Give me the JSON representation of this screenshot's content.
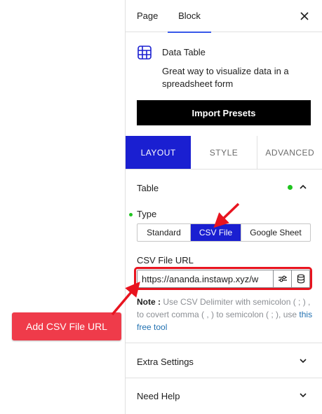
{
  "sidebar_tabs": {
    "page": "Page",
    "block": "Block"
  },
  "block": {
    "title": "Data Table",
    "description": "Great way to visualize data in a spreadsheet form",
    "import_button": "Import Presets"
  },
  "sub_tabs": [
    "LAYOUT",
    "STYLE",
    "ADVANCED"
  ],
  "table_section": {
    "title": "Table",
    "type_label": "Type",
    "type_options": [
      "Standard",
      "CSV File",
      "Google Sheet"
    ],
    "selected_type": "CSV File",
    "csv_label": "CSV File URL",
    "csv_url": "https://ananda.instawp.xyz/w",
    "note_label": "Note :",
    "note_text": " Use CSV Delimiter with semicolon ( ; ) , to covert comma ( , ) to semicolon ( ; ), use ",
    "note_link": "this free tool"
  },
  "sections": {
    "extra": "Extra Settings",
    "help": "Need Help"
  },
  "callout": "Add CSV File URL",
  "colors": {
    "accent": "#1a1fd1",
    "highlight": "#e8141f",
    "callout": "#ef3b4a",
    "status_dot": "#1fc41f"
  }
}
